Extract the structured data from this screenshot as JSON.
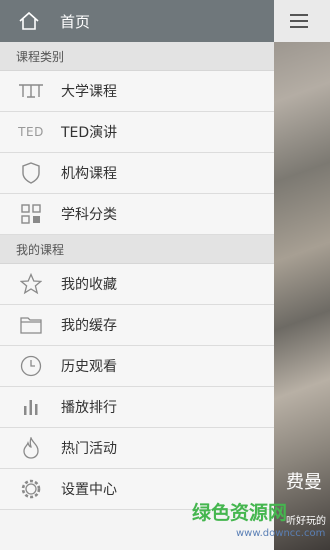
{
  "header": {
    "title": "首页",
    "icon": "home-icon"
  },
  "sections": {
    "course_types": "课程类别",
    "my_courses": "我的课程"
  },
  "course_items": [
    {
      "label": "大学课程",
      "icon": "university-icon"
    },
    {
      "label": "TED演讲",
      "icon": "ted-icon",
      "icon_text": "TED"
    },
    {
      "label": "机构课程",
      "icon": "shield-icon"
    },
    {
      "label": "学科分类",
      "icon": "grid-icon"
    }
  ],
  "my_items": [
    {
      "label": "我的收藏",
      "icon": "star-icon"
    },
    {
      "label": "我的缓存",
      "icon": "folder-icon"
    },
    {
      "label": "历史观看",
      "icon": "clock-icon"
    },
    {
      "label": "播放排行",
      "icon": "bar-chart-icon"
    },
    {
      "label": "热门活动",
      "icon": "flame-icon"
    },
    {
      "label": "设置中心",
      "icon": "gear-icon"
    }
  ],
  "panel": {
    "menu_icon": "menu-icon",
    "big_text": "费曼",
    "small_text": "听好玩的"
  },
  "watermark": {
    "text": "绿色资源网",
    "url_text": "www.downcc.com"
  }
}
